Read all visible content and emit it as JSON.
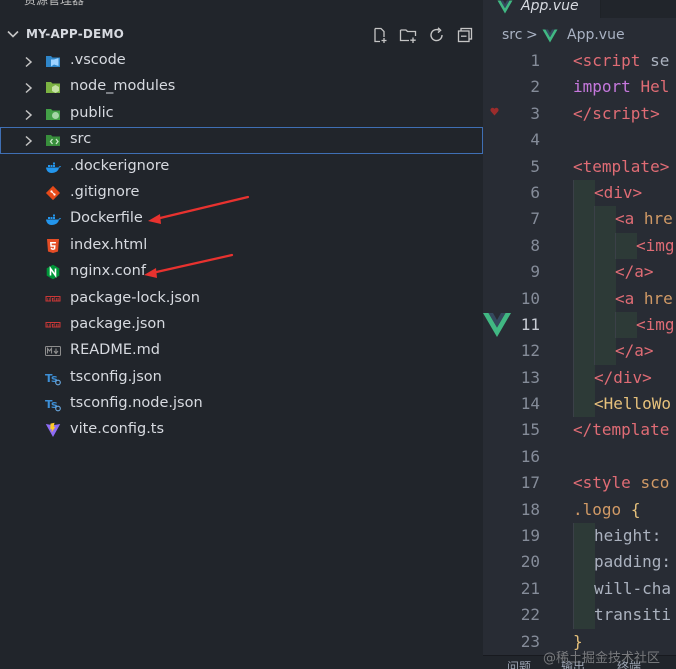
{
  "explorer": {
    "title": "资源管理器",
    "more_glyph": "···",
    "section_title": "MY-APP-DEMO",
    "actions": [
      "new-file-icon",
      "new-folder-icon",
      "refresh-icon",
      "collapse-all-icon"
    ],
    "items": [
      {
        "name": ".vscode",
        "kind": "folder",
        "icon": "vscode-folder-icon"
      },
      {
        "name": "node_modules",
        "kind": "folder",
        "icon": "node-folder-icon"
      },
      {
        "name": "public",
        "kind": "folder",
        "icon": "public-folder-icon"
      },
      {
        "name": "src",
        "kind": "folder",
        "icon": "src-folder-icon",
        "selected": true
      },
      {
        "name": ".dockerignore",
        "kind": "file",
        "icon": "docker-icon"
      },
      {
        "name": ".gitignore",
        "kind": "file",
        "icon": "git-icon"
      },
      {
        "name": "Dockerfile",
        "kind": "file",
        "icon": "docker-icon",
        "annotated": true
      },
      {
        "name": "index.html",
        "kind": "file",
        "icon": "html5-icon"
      },
      {
        "name": "nginx.conf",
        "kind": "file",
        "icon": "nginx-icon",
        "annotated": true
      },
      {
        "name": "package-lock.json",
        "kind": "file",
        "icon": "npm-icon"
      },
      {
        "name": "package.json",
        "kind": "file",
        "icon": "npm-icon"
      },
      {
        "name": "README.md",
        "kind": "file",
        "icon": "markdown-icon"
      },
      {
        "name": "tsconfig.json",
        "kind": "file",
        "icon": "typescript-config-icon"
      },
      {
        "name": "tsconfig.node.json",
        "kind": "file",
        "icon": "typescript-config-icon"
      },
      {
        "name": "vite.config.ts",
        "kind": "file",
        "icon": "vite-icon"
      }
    ]
  },
  "editor": {
    "tab_label": "App.vue",
    "breadcrumb": {
      "folder": "src",
      "separator": ">",
      "file": "App.vue"
    },
    "lines": [
      {
        "n": "1",
        "tokens": [
          [
            "tag",
            "<"
          ],
          [
            "tag",
            "script"
          ],
          [
            "fg",
            " se"
          ]
        ]
      },
      {
        "n": "2",
        "tokens": [
          [
            "kw",
            "import"
          ],
          [
            "fg",
            " "
          ],
          [
            "tag",
            "Hel"
          ]
        ]
      },
      {
        "n": "3",
        "tokens": [
          [
            "tag",
            "</"
          ],
          [
            "tag",
            "script"
          ],
          [
            "tag",
            ">"
          ]
        ]
      },
      {
        "n": "4",
        "tokens": []
      },
      {
        "n": "5",
        "tokens": [
          [
            "tag",
            "<template>"
          ]
        ]
      },
      {
        "n": "6",
        "indent": 1,
        "tokens": [
          [
            "tag",
            "<div>"
          ]
        ]
      },
      {
        "n": "7",
        "indent": 2,
        "tokens": [
          [
            "tag",
            "<a"
          ],
          [
            "fg",
            " "
          ],
          [
            "cls",
            "hre"
          ]
        ]
      },
      {
        "n": "8",
        "indent": 3,
        "tokens": [
          [
            "tag",
            "<img"
          ]
        ]
      },
      {
        "n": "9",
        "indent": 2,
        "tokens": [
          [
            "tag",
            "</a>"
          ]
        ]
      },
      {
        "n": "10",
        "indent": 2,
        "tokens": [
          [
            "tag",
            "<a"
          ],
          [
            "fg",
            " "
          ],
          [
            "cls",
            "hre"
          ]
        ]
      },
      {
        "n": "11",
        "indent": 3,
        "active": true,
        "tokens": [
          [
            "tag",
            "<img"
          ]
        ]
      },
      {
        "n": "12",
        "indent": 2,
        "tokens": [
          [
            "tag",
            "</a>"
          ]
        ]
      },
      {
        "n": "13",
        "indent": 1,
        "tokens": [
          [
            "tag",
            "</div>"
          ]
        ]
      },
      {
        "n": "14",
        "indent": 1,
        "tokens": [
          [
            "comp",
            "<HelloWo"
          ]
        ]
      },
      {
        "n": "15",
        "tokens": [
          [
            "tag",
            "</template"
          ]
        ]
      },
      {
        "n": "16",
        "tokens": []
      },
      {
        "n": "17",
        "tokens": [
          [
            "tag",
            "<style"
          ],
          [
            "fg",
            " "
          ],
          [
            "cls",
            "sco"
          ]
        ]
      },
      {
        "n": "18",
        "tokens": [
          [
            "cls",
            ".logo"
          ],
          [
            "fg",
            " "
          ],
          [
            "comp",
            "{"
          ]
        ]
      },
      {
        "n": "19",
        "indent": 1,
        "tokens": [
          [
            "prop",
            "height:"
          ]
        ]
      },
      {
        "n": "20",
        "indent": 1,
        "tokens": [
          [
            "prop",
            "padding:"
          ]
        ]
      },
      {
        "n": "21",
        "indent": 1,
        "tokens": [
          [
            "prop",
            "will-cha"
          ]
        ]
      },
      {
        "n": "22",
        "indent": 1,
        "tokens": [
          [
            "prop",
            "transiti"
          ]
        ]
      },
      {
        "n": "23",
        "tokens": [
          [
            "comp",
            "}"
          ]
        ]
      }
    ]
  },
  "statusbar": {
    "items": [
      "问题",
      "输出",
      "终端"
    ]
  },
  "watermark": "@稀土掘金技术社区",
  "colors": {
    "accent_red_arrow": "#e8322f",
    "selection_outline": "#3f6fb4",
    "vue_green": "#41b883"
  }
}
